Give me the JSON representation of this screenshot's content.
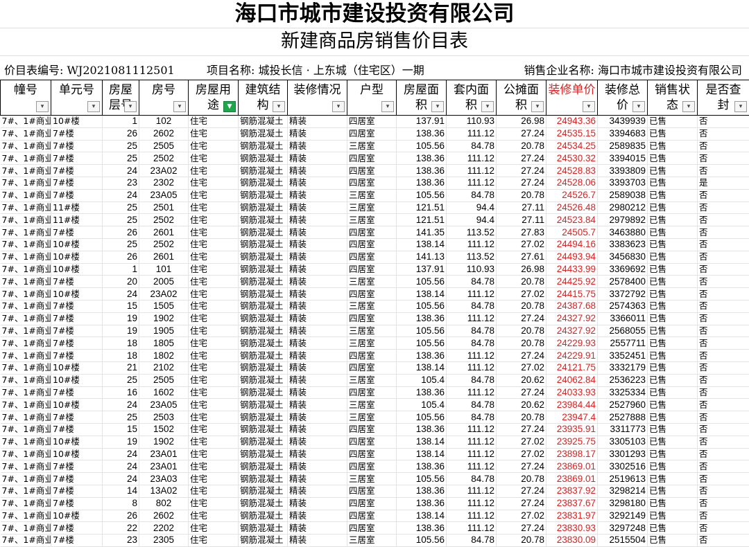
{
  "header": {
    "company_title": "海口市城市建设投资有限公司",
    "table_title": "新建商品房销售价目表"
  },
  "info": {
    "list_no": "价目表编号: WJ2021081112501",
    "project": "项目名称: 城投长信 · 上东城（住宅区）一期",
    "enterprise": "销售企业名称: 海口市城市建设投资有限公司"
  },
  "columns": [
    {
      "label": "幢号",
      "filter": false
    },
    {
      "label": "单元号",
      "filter": false
    },
    {
      "label": "房屋\n层号",
      "filter": false
    },
    {
      "label": "房号",
      "filter": false
    },
    {
      "label": "房屋用\n途",
      "filter": true
    },
    {
      "label": "建筑结\n构",
      "filter": false
    },
    {
      "label": "装修情况",
      "filter": false
    },
    {
      "label": "户型",
      "filter": false
    },
    {
      "label": "房屋面\n积",
      "filter": false
    },
    {
      "label": "套内面\n积",
      "filter": false
    },
    {
      "label": "公摊面\n积",
      "filter": false
    },
    {
      "label": "装修单价",
      "filter": false,
      "red": true
    },
    {
      "label": "装修总\n价",
      "filter": false
    },
    {
      "label": "销售状\n态",
      "filter": false
    },
    {
      "label": "是否查\n封",
      "filter": false
    }
  ],
  "rows": [
    [
      "7#、1#商业",
      "10#楼",
      "1",
      "102",
      "住宅",
      "钢筋混凝土",
      "精装",
      "四居室",
      "137.91",
      "110.93",
      "26.98",
      "24943.36",
      "3439939",
      "已售",
      "否"
    ],
    [
      "7#、1#商业",
      "7#楼",
      "26",
      "2602",
      "住宅",
      "钢筋混凝土",
      "精装",
      "四居室",
      "138.36",
      "111.12",
      "27.24",
      "24535.15",
      "3394683",
      "已售",
      "否"
    ],
    [
      "7#、1#商业",
      "7#楼",
      "25",
      "2505",
      "住宅",
      "钢筋混凝土",
      "精装",
      "三居室",
      "105.56",
      "84.78",
      "20.78",
      "24534.25",
      "2589835",
      "已售",
      "否"
    ],
    [
      "7#、1#商业",
      "7#楼",
      "25",
      "2502",
      "住宅",
      "钢筋混凝土",
      "精装",
      "四居室",
      "138.36",
      "111.12",
      "27.24",
      "24530.32",
      "3394015",
      "已售",
      "否"
    ],
    [
      "7#、1#商业",
      "7#楼",
      "24",
      "23A02",
      "住宅",
      "钢筋混凝土",
      "精装",
      "四居室",
      "138.36",
      "111.12",
      "27.24",
      "24528.83",
      "3393809",
      "已售",
      "否"
    ],
    [
      "7#、1#商业",
      "7#楼",
      "23",
      "2302",
      "住宅",
      "钢筋混凝土",
      "精装",
      "四居室",
      "138.36",
      "111.12",
      "27.24",
      "24528.06",
      "3393703",
      "已售",
      "是"
    ],
    [
      "7#、1#商业",
      "7#楼",
      "24",
      "23A05",
      "住宅",
      "钢筋混凝土",
      "精装",
      "三居室",
      "105.56",
      "84.78",
      "20.78",
      "24526.7",
      "2589038",
      "已售",
      "否"
    ],
    [
      "7#、1#商业",
      "11#楼",
      "25",
      "2501",
      "住宅",
      "钢筋混凝土",
      "精装",
      "三居室",
      "121.51",
      "94.4",
      "27.11",
      "24526.48",
      "2980212",
      "已售",
      "否"
    ],
    [
      "7#、1#商业",
      "11#楼",
      "25",
      "2502",
      "住宅",
      "钢筋混凝土",
      "精装",
      "三居室",
      "121.51",
      "94.4",
      "27.11",
      "24523.84",
      "2979892",
      "已售",
      "否"
    ],
    [
      "7#、1#商业",
      "7#楼",
      "26",
      "2601",
      "住宅",
      "钢筋混凝土",
      "精装",
      "四居室",
      "141.35",
      "113.52",
      "27.83",
      "24505.7",
      "3463880",
      "已售",
      "否"
    ],
    [
      "7#、1#商业",
      "10#楼",
      "25",
      "2502",
      "住宅",
      "钢筋混凝土",
      "精装",
      "四居室",
      "138.14",
      "111.12",
      "27.02",
      "24494.16",
      "3383623",
      "已售",
      "否"
    ],
    [
      "7#、1#商业",
      "10#楼",
      "26",
      "2601",
      "住宅",
      "钢筋混凝土",
      "精装",
      "四居室",
      "141.13",
      "113.52",
      "27.61",
      "24493.94",
      "3456830",
      "已售",
      "否"
    ],
    [
      "7#、1#商业",
      "10#楼",
      "1",
      "101",
      "住宅",
      "钢筋混凝土",
      "精装",
      "四居室",
      "137.91",
      "110.93",
      "26.98",
      "24433.99",
      "3369692",
      "已售",
      "否"
    ],
    [
      "7#、1#商业",
      "7#楼",
      "20",
      "2005",
      "住宅",
      "钢筋混凝土",
      "精装",
      "三居室",
      "105.56",
      "84.78",
      "20.78",
      "24425.92",
      "2578400",
      "已售",
      "否"
    ],
    [
      "7#、1#商业",
      "10#楼",
      "24",
      "23A02",
      "住宅",
      "钢筋混凝土",
      "精装",
      "四居室",
      "138.14",
      "111.12",
      "27.02",
      "24415.75",
      "3372792",
      "已售",
      "否"
    ],
    [
      "7#、1#商业",
      "7#楼",
      "15",
      "1505",
      "住宅",
      "钢筋混凝土",
      "精装",
      "三居室",
      "105.56",
      "84.78",
      "20.78",
      "24387.68",
      "2574363",
      "已售",
      "否"
    ],
    [
      "7#、1#商业",
      "7#楼",
      "19",
      "1902",
      "住宅",
      "钢筋混凝土",
      "精装",
      "四居室",
      "138.36",
      "111.12",
      "27.24",
      "24327.92",
      "3366011",
      "已售",
      "否"
    ],
    [
      "7#、1#商业",
      "7#楼",
      "19",
      "1905",
      "住宅",
      "钢筋混凝土",
      "精装",
      "三居室",
      "105.56",
      "84.78",
      "20.78",
      "24327.92",
      "2568055",
      "已售",
      "否"
    ],
    [
      "7#、1#商业",
      "7#楼",
      "18",
      "1805",
      "住宅",
      "钢筋混凝土",
      "精装",
      "三居室",
      "105.56",
      "84.78",
      "20.78",
      "24229.93",
      "2557711",
      "已售",
      "否"
    ],
    [
      "7#、1#商业",
      "7#楼",
      "18",
      "1802",
      "住宅",
      "钢筋混凝土",
      "精装",
      "四居室",
      "138.36",
      "111.12",
      "27.24",
      "24229.91",
      "3352451",
      "已售",
      "否"
    ],
    [
      "7#、1#商业",
      "10#楼",
      "21",
      "2102",
      "住宅",
      "钢筋混凝土",
      "精装",
      "四居室",
      "138.14",
      "111.12",
      "27.02",
      "24121.75",
      "3332179",
      "已售",
      "否"
    ],
    [
      "7#、1#商业",
      "10#楼",
      "25",
      "2505",
      "住宅",
      "钢筋混凝土",
      "精装",
      "三居室",
      "105.4",
      "84.78",
      "20.62",
      "24062.84",
      "2536223",
      "已售",
      "否"
    ],
    [
      "7#、1#商业",
      "7#楼",
      "16",
      "1602",
      "住宅",
      "钢筋混凝土",
      "精装",
      "四居室",
      "138.36",
      "111.12",
      "27.24",
      "24033.93",
      "3325334",
      "已售",
      "否"
    ],
    [
      "7#、1#商业",
      "10#楼",
      "24",
      "23A05",
      "住宅",
      "钢筋混凝土",
      "精装",
      "三居室",
      "105.4",
      "84.78",
      "20.62",
      "23984.44",
      "2527960",
      "已售",
      "否"
    ],
    [
      "7#、1#商业",
      "7#楼",
      "25",
      "2503",
      "住宅",
      "钢筋混凝土",
      "精装",
      "三居室",
      "105.56",
      "84.78",
      "20.78",
      "23947.4",
      "2527888",
      "已售",
      "否"
    ],
    [
      "7#、1#商业",
      "7#楼",
      "15",
      "1502",
      "住宅",
      "钢筋混凝土",
      "精装",
      "四居室",
      "138.36",
      "111.12",
      "27.24",
      "23935.91",
      "3311773",
      "已售",
      "否"
    ],
    [
      "7#、1#商业",
      "10#楼",
      "19",
      "1902",
      "住宅",
      "钢筋混凝土",
      "精装",
      "四居室",
      "138.14",
      "111.12",
      "27.02",
      "23925.75",
      "3305103",
      "已售",
      "否"
    ],
    [
      "7#、1#商业",
      "10#楼",
      "24",
      "23A01",
      "住宅",
      "钢筋混凝土",
      "精装",
      "四居室",
      "138.14",
      "111.12",
      "27.02",
      "23898.17",
      "3301293",
      "已售",
      "否"
    ],
    [
      "7#、1#商业",
      "7#楼",
      "24",
      "23A01",
      "住宅",
      "钢筋混凝土",
      "精装",
      "四居室",
      "138.36",
      "111.12",
      "27.24",
      "23869.01",
      "3302516",
      "已售",
      "否"
    ],
    [
      "7#、1#商业",
      "7#楼",
      "24",
      "23A03",
      "住宅",
      "钢筋混凝土",
      "精装",
      "三居室",
      "105.56",
      "84.78",
      "20.78",
      "23869.01",
      "2519613",
      "已售",
      "否"
    ],
    [
      "7#、1#商业",
      "7#楼",
      "14",
      "13A02",
      "住宅",
      "钢筋混凝土",
      "精装",
      "四居室",
      "138.36",
      "111.12",
      "27.24",
      "23837.92",
      "3298214",
      "已售",
      "否"
    ],
    [
      "7#、1#商业",
      "7#楼",
      "8",
      "802",
      "住宅",
      "钢筋混凝土",
      "精装",
      "四居室",
      "138.36",
      "111.12",
      "27.24",
      "23837.67",
      "3298180",
      "已售",
      "否"
    ],
    [
      "7#、1#商业",
      "10#楼",
      "26",
      "2602",
      "住宅",
      "钢筋混凝土",
      "精装",
      "四居室",
      "138.14",
      "111.12",
      "27.02",
      "23831.97",
      "3292149",
      "已售",
      "否"
    ],
    [
      "7#、1#商业",
      "7#楼",
      "22",
      "2202",
      "住宅",
      "钢筋混凝土",
      "精装",
      "四居室",
      "138.36",
      "111.12",
      "27.24",
      "23830.93",
      "3297248",
      "已售",
      "否"
    ],
    [
      "7#、1#商业",
      "7#楼",
      "23",
      "2305",
      "住宅",
      "钢筋混凝土",
      "精装",
      "三居室",
      "105.56",
      "84.78",
      "20.78",
      "23830.09",
      "2515504",
      "已售",
      "否"
    ]
  ]
}
